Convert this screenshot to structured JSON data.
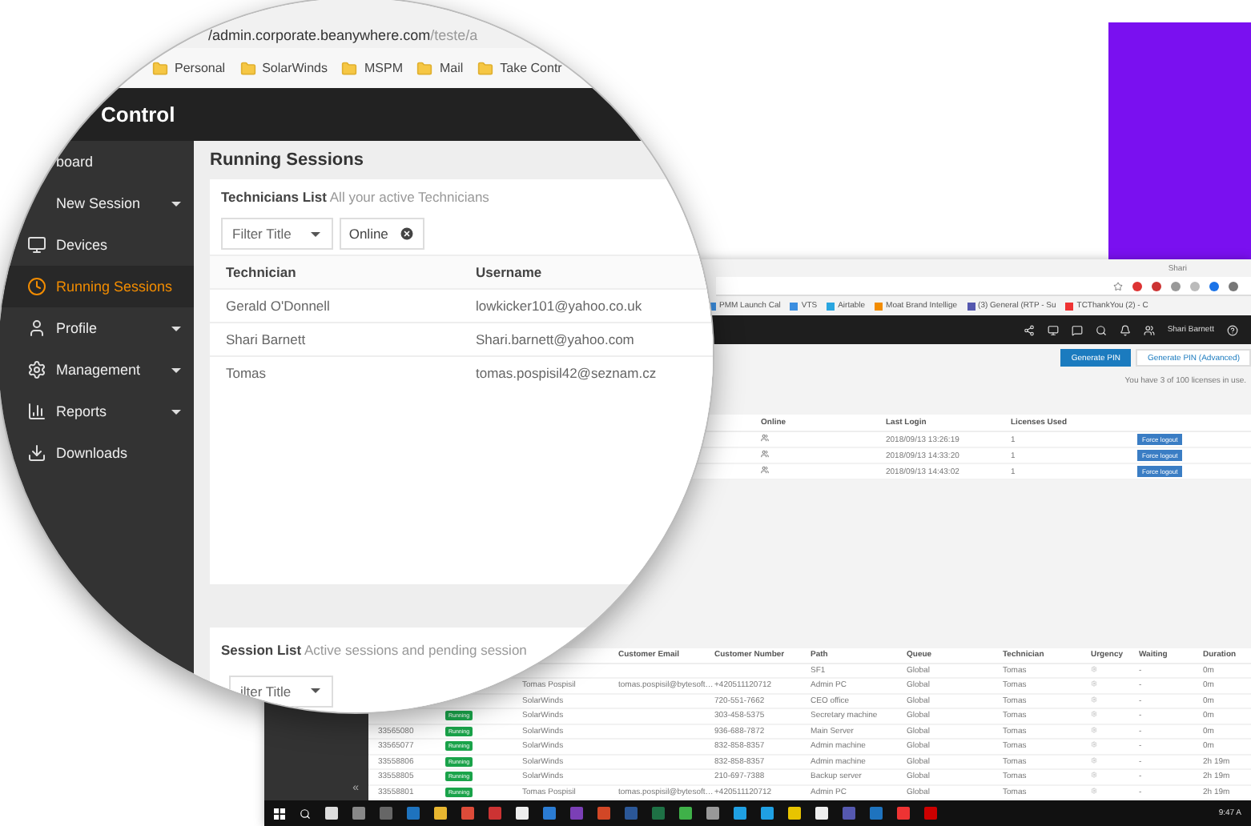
{
  "magnifier": {
    "address": {
      "host": "/admin.corporate.beanywhere.com",
      "path": "/teste/a"
    },
    "bookmarks": [
      "Personal",
      "SolarWinds",
      "MSPM",
      "Mail",
      "Take Contr"
    ],
    "app_title": "Control",
    "sidebar": [
      {
        "label": "board",
        "has_submenu": false,
        "selected": false
      },
      {
        "label": "New Session",
        "has_submenu": true,
        "selected": false
      },
      {
        "label": "Devices",
        "has_submenu": false,
        "selected": false
      },
      {
        "label": "Running Sessions",
        "has_submenu": false,
        "selected": true
      },
      {
        "label": "Profile",
        "has_submenu": true,
        "selected": false
      },
      {
        "label": "Management",
        "has_submenu": true,
        "selected": false
      },
      {
        "label": "Reports",
        "has_submenu": true,
        "selected": false
      },
      {
        "label": "Downloads",
        "has_submenu": false,
        "selected": false
      }
    ],
    "page_title": "Running Sessions",
    "technicians_card": {
      "title": "Technicians List",
      "subtitle": "All your active Technicians",
      "filter": {
        "placeholder": "Filter Title"
      },
      "chip": "Online",
      "columns": [
        "Technician",
        "Username"
      ],
      "rows": [
        [
          "Gerald O'Donnell",
          "lowkicker101@yahoo.co.uk"
        ],
        [
          "Shari Barnett",
          "Shari.barnett@yahoo.com"
        ],
        [
          "Tomas",
          "tomas.pospisil42@seznam.cz"
        ]
      ]
    },
    "session_card": {
      "title": "Session List",
      "subtitle": "Active sessions and pending session",
      "filter": {
        "placeholder": "ilter Title"
      }
    }
  },
  "window": {
    "title_user": "Shari",
    "bookmarks": [
      "PMM Launch Cal",
      "VTS",
      "Airtable",
      "Moat Brand Intellige",
      "(3) General (RTP - Su",
      "TCThankYou (2) - C"
    ],
    "user": "Shari Barnett",
    "buttons": [
      "Generate PIN",
      "Generate PIN (Advanced)"
    ],
    "license_note": "You have 3 of 100 licenses in use.",
    "technicians": {
      "columns": [
        "Online",
        "Last Login",
        "Licenses Used"
      ],
      "rows": [
        {
          "last_login": "2018/09/13 13:26:19",
          "licenses": "1",
          "action": "Force logout"
        },
        {
          "last_login": "2018/09/13 14:33:20",
          "licenses": "1",
          "action": "Force logout"
        },
        {
          "last_login": "2018/09/13 14:43:02",
          "licenses": "1",
          "action": "Force logout"
        }
      ]
    },
    "sessions": {
      "columns": [
        "Customer Email",
        "Customer Number",
        "Path",
        "Queue",
        "Technician",
        "Urgency",
        "Waiting",
        "Duration"
      ],
      "rows": [
        {
          "path": "SF1",
          "queue": "Global",
          "technician": "Tomas",
          "waiting": "-",
          "duration": "0m"
        },
        {
          "name": "Tomas Pospisil",
          "email": "tomas.pospisil@bytesoft…",
          "number": "+420511120712",
          "path": "Admin PC",
          "queue": "Global",
          "technician": "Tomas",
          "waiting": "-",
          "duration": "0m"
        },
        {
          "name": "SolarWinds",
          "number": "720-551-7662",
          "path": "CEO office",
          "queue": "Global",
          "technician": "Tomas",
          "waiting": "-",
          "duration": "0m"
        },
        {
          "status": "Running",
          "name": "SolarWinds",
          "number": "303-458-5375",
          "path": "Secretary machine",
          "queue": "Global",
          "technician": "Tomas",
          "waiting": "-",
          "duration": "0m"
        },
        {
          "id": "33565080",
          "status": "Running",
          "name": "SolarWinds",
          "number": "936-688-7872",
          "path": "Main Server",
          "queue": "Global",
          "technician": "Tomas",
          "waiting": "-",
          "duration": "0m"
        },
        {
          "id": "33565077",
          "status": "Running",
          "name": "SolarWinds",
          "number": "832-858-8357",
          "path": "Admin machine",
          "queue": "Global",
          "technician": "Tomas",
          "waiting": "-",
          "duration": "0m"
        },
        {
          "id": "33558806",
          "status": "Running",
          "name": "SolarWinds",
          "number": "832-858-8357",
          "path": "Admin machine",
          "queue": "Global",
          "technician": "Tomas",
          "waiting": "-",
          "duration": "2h 19m"
        },
        {
          "id": "33558805",
          "status": "Running",
          "name": "SolarWinds",
          "number": "210-697-7388",
          "path": "Backup server",
          "queue": "Global",
          "technician": "Tomas",
          "waiting": "-",
          "duration": "2h 19m"
        },
        {
          "id": "33558801",
          "status": "Running",
          "name": "Tomas Pospisil",
          "email": "tomas.pospisil@bytesoft…",
          "number": "+420511120712",
          "path": "Admin PC",
          "queue": "Global",
          "technician": "Tomas",
          "waiting": "-",
          "duration": "2h 19m"
        }
      ]
    },
    "collapse": "«",
    "clock": "9:47 A"
  }
}
